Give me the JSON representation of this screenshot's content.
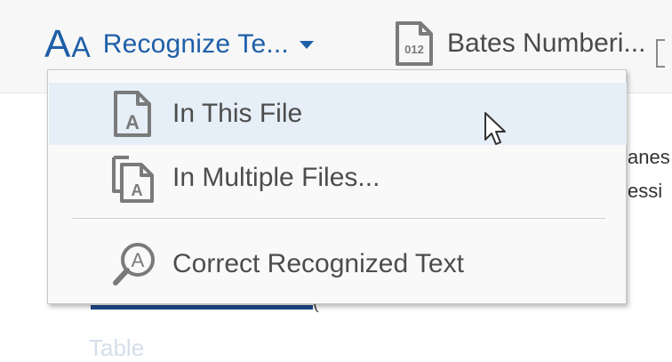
{
  "toolbar": {
    "recognize_icon_text": "AA",
    "recognize_label": "Recognize Te...",
    "bates_icon_text": "012",
    "bates_label": "Bates Numberi..."
  },
  "background": {
    "fragment_1": "anes",
    "fragment_2": "essi",
    "paren_fragment": "(",
    "faded_text": "Table"
  },
  "menu": {
    "items": [
      {
        "label": "In This File",
        "icon": "file-ocr-icon",
        "highlighted": true
      },
      {
        "label": "In Multiple Files...",
        "icon": "multiple-files-ocr-icon"
      },
      {
        "label": "Correct Recognized Text",
        "icon": "magnify-text-icon"
      }
    ]
  },
  "colors": {
    "accent": "#1f5fa8",
    "highlight": "#e6eef7",
    "icon_gray": "#7a7a7a"
  }
}
